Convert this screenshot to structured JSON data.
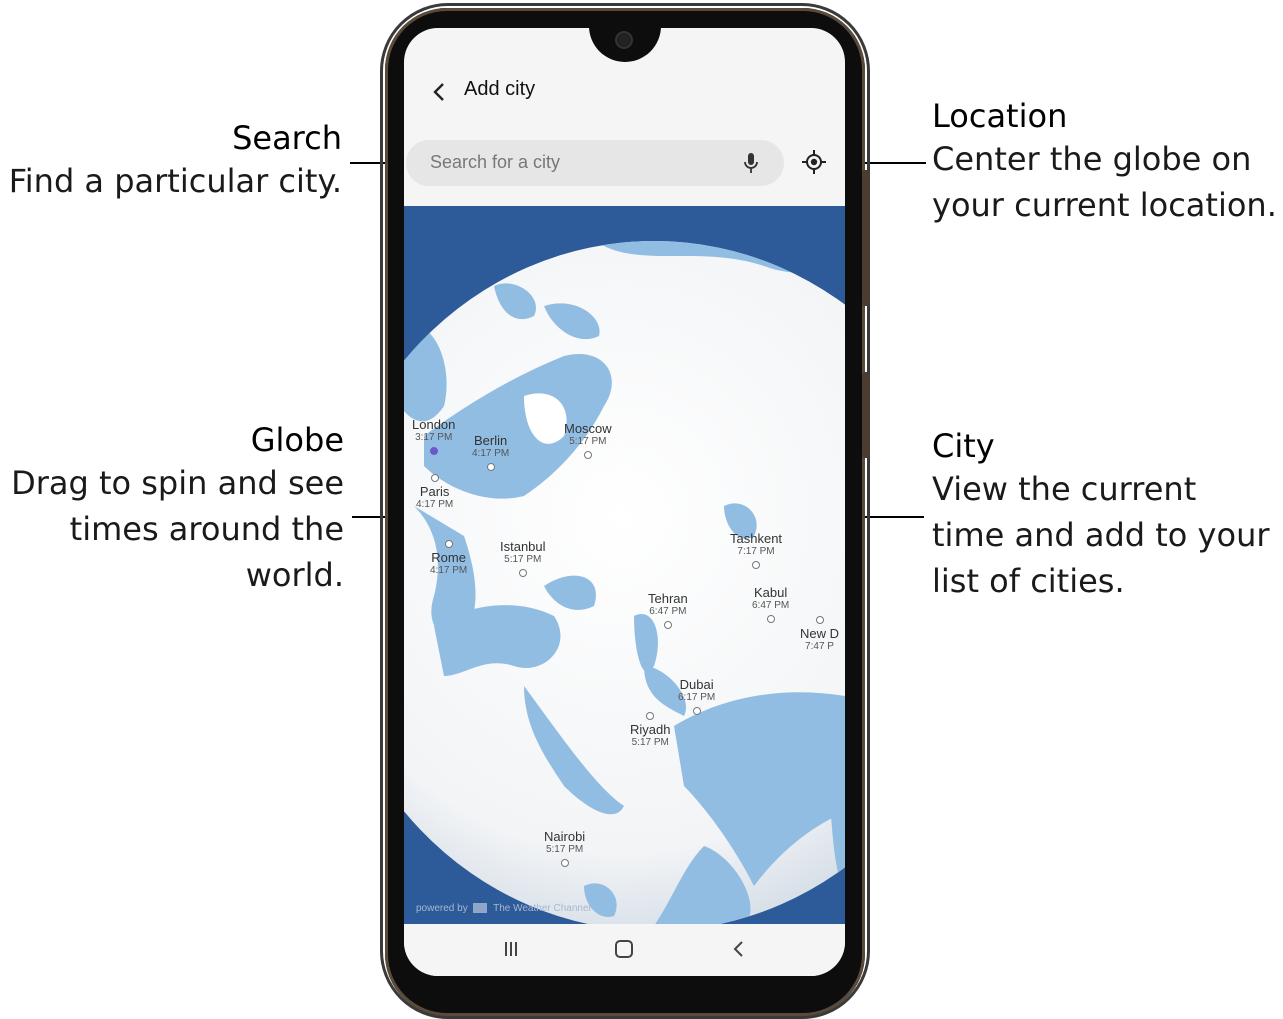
{
  "callouts": {
    "search": {
      "title": "Search",
      "desc": "Find a particular city."
    },
    "globe": {
      "title": "Globe",
      "desc_lines": [
        "Drag to spin and see",
        "times around the",
        "world."
      ]
    },
    "location": {
      "title": "Location",
      "desc_lines": [
        "Center the globe on",
        "your current location."
      ]
    },
    "city": {
      "title": "City",
      "desc_lines": [
        "View the current",
        "time and add to your",
        "list of cities."
      ]
    }
  },
  "header": {
    "title": "Add city",
    "back_icon": "chevron-left-icon"
  },
  "search": {
    "placeholder": "Search for a city",
    "mic_icon": "microphone-icon",
    "location_icon": "my-location-icon"
  },
  "cities": [
    {
      "name": "London",
      "time": "3:17 PM"
    },
    {
      "name": "Berlin",
      "time": "4:17 PM"
    },
    {
      "name": "Moscow",
      "time": "5:17 PM"
    },
    {
      "name": "Paris",
      "time": "4:17 PM"
    },
    {
      "name": "Rome",
      "time": "4:17 PM"
    },
    {
      "name": "Istanbul",
      "time": "5:17 PM"
    },
    {
      "name": "Tashkent",
      "time": "7:17 PM"
    },
    {
      "name": "Kabul",
      "time": "6:47 PM"
    },
    {
      "name": "Tehran",
      "time": "6:47 PM"
    },
    {
      "name": "New D",
      "time": "7:47 P"
    },
    {
      "name": "Dubai",
      "time": "6:17 PM"
    },
    {
      "name": "Riyadh",
      "time": "5:17 PM"
    },
    {
      "name": "Nairobi",
      "time": "5:17 PM"
    }
  ],
  "powered_by": {
    "prefix": "powered by",
    "brand": "The Weather Channel"
  },
  "navbar": {
    "recent_icon": "recent-apps-icon",
    "home_icon": "home-icon",
    "back_icon": "back-icon"
  },
  "colors": {
    "ocean": "#2d5a99",
    "globe_land": "#ffffff",
    "globe_water": "#92bde3",
    "leader": "#000000"
  }
}
